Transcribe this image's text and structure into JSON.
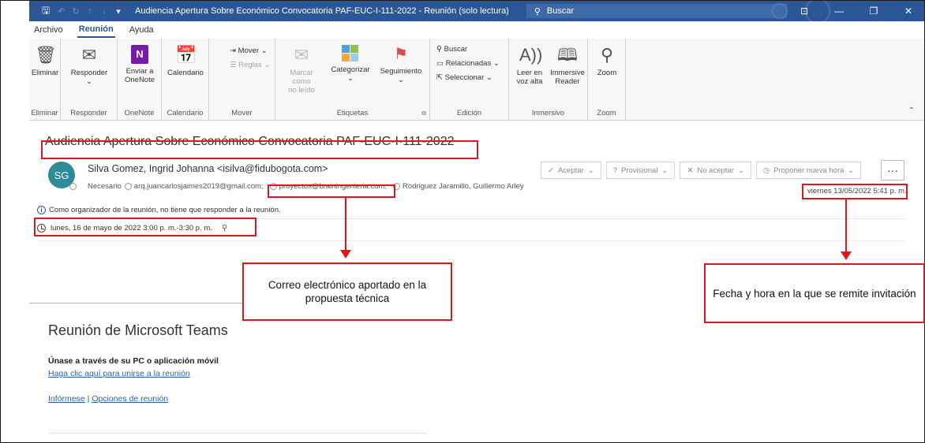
{
  "window": {
    "title": "Audiencia Apertura Sobre Económico Convocatoria PAF-EUC-I-111-2022  -  Reunión  (solo lectura)",
    "search_placeholder": "Buscar",
    "accent_color": "#2b5797"
  },
  "menu": {
    "tabs": [
      {
        "label": "Archivo"
      },
      {
        "label": "Reunión",
        "active": true
      },
      {
        "label": "Ayuda"
      }
    ]
  },
  "ribbon": {
    "groups": {
      "eliminar": {
        "label": "Eliminar",
        "button": "Eliminar"
      },
      "responder": {
        "label": "Responder",
        "button": "Responder"
      },
      "onenote": {
        "label": "OneNote",
        "button_line1": "Enviar a",
        "button_line2": "OneNote"
      },
      "calendario": {
        "label": "Calendario",
        "button": "Calendario"
      },
      "mover": {
        "label": "Mover",
        "mover": "Mover",
        "reglas": "Reglas"
      },
      "etiquetas": {
        "label": "Etiquetas",
        "marcar_line1": "Marcar como",
        "marcar_line2": "no leído",
        "categorizar": "Categorizar",
        "seguimiento": "Seguimiento"
      },
      "edicion": {
        "label": "Edición",
        "buscar": "Buscar",
        "relacionadas": "Relacionadas",
        "seleccionar": "Seleccionar"
      },
      "inmersivo": {
        "label": "Inmersivo",
        "leer_line1": "Leer en",
        "leer_line2": "voz alta",
        "reader_line1": "Immersive",
        "reader_line2": "Reader"
      },
      "zoom": {
        "label": "Zoom",
        "button": "Zoom"
      }
    }
  },
  "message": {
    "subject": "Audiencia Apertura Sobre Económico Convocatoria PAF-EUC-I-111-2022",
    "avatar_initials": "SG",
    "avatar_color": "#2e8b9a",
    "sender": "Silva Gomez, Ingrid Johanna <isilva@fidubogota.com>",
    "recipients_label": "Necesario",
    "recipients": [
      "arq.juancarlosjaimes2019@gmail.com;",
      "proyectos@brainingenieria.com;",
      "Rodriguez Jaramillo, Guillermo Arley"
    ],
    "actions": {
      "accept": "Aceptar",
      "tentative": "Provisional",
      "decline": "No aceptar",
      "propose": "Proponer nueva hora",
      "more": "···"
    },
    "sent_date": "viernes 13/05/2022 5:41 p. m.",
    "organizer_note": "Como organizador de la reunión, no tiene que responder a la reunión.",
    "meeting_time": "lunes, 16 de mayo de 2022 3:00 p. m.-3:30 p. m."
  },
  "body": {
    "teams_title": "Reunión de Microsoft Teams",
    "join_title": "Únase a través de su PC o aplicación móvil",
    "join_link": "Haga clic aquí para unirse a la reunión",
    "info_link": "Infórmese",
    "separator": " | ",
    "options_link": "Opciones de reunión"
  },
  "annotations": {
    "color": "#e3141b",
    "email_callout": "Correo electrónico aportado en la propuesta técnica",
    "date_callout": "Fecha y hora en la que se remite invitación"
  }
}
